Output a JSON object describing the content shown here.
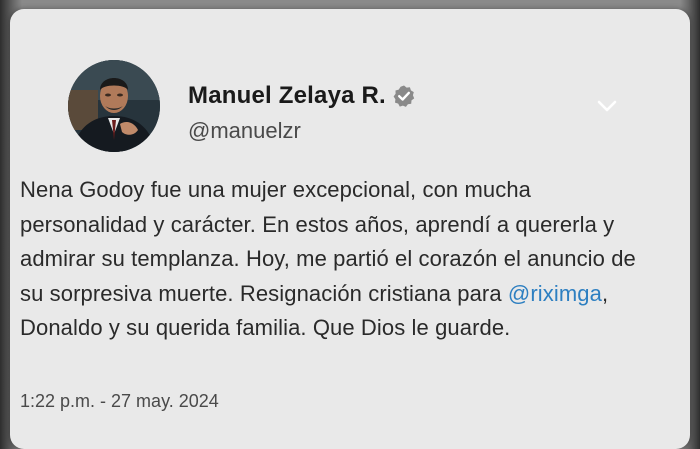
{
  "tweet": {
    "author_name": "Manuel Zelaya R.",
    "handle": "@manuelzr",
    "text_before_mention": "Nena Godoy fue una mujer excepcional, con mucha personalidad y carácter. En estos años, aprendí a quererla y admirar su templanza. Hoy, me partió el corazón el anuncio de su sorpresiva muerte. Resignación cristiana para ",
    "mention": "@riximga",
    "text_after_mention": ", Donaldo y su querida familia. Que Dios le guarde.",
    "timestamp": "1:22 p.m. - 27 may. 2024"
  },
  "icons": {
    "verified": "verified-badge-icon",
    "more": "chevron-down-icon"
  },
  "colors": {
    "card_background": "#e9e9e9",
    "mention_link": "#2d7fc1",
    "text": "#2a2a2a",
    "secondary_text": "#4a4a4a"
  }
}
